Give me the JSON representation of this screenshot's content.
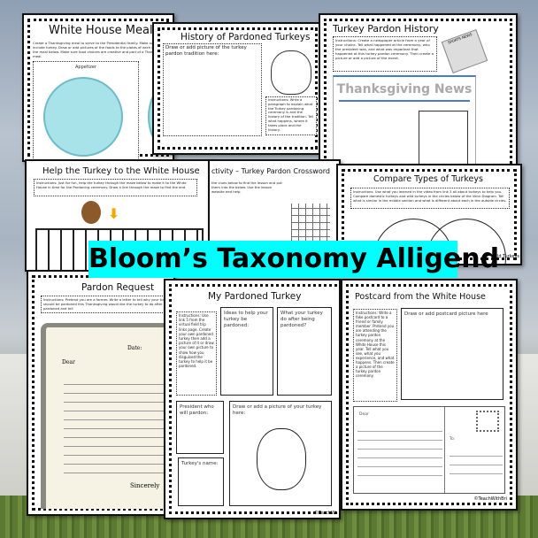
{
  "banner": {
    "title": "Bloom’s Taxonomy Alligend",
    "color": "#00ffff"
  },
  "pages": {
    "meal": {
      "title": "White House Meal",
      "instructions": "Create a Thanksgiving meal to serve to the Presidential family. Make sure to include turkey. Draw or add pictures of the foods to the plates of each course of the meal below. Make sure food choices are creative and part of a Thanksgiving meal.",
      "section": "Appetizer"
    },
    "history": {
      "title": "History of Pardoned Turkeys",
      "draw_label": "Draw or add picture of the turkey pardon tradition here:",
      "instructions": "Instructions: Write a paragraph to explain what the Turkey pardoning ceremony is and the history of the tradition. Tell what happens, where it takes place and the history."
    },
    "pardon_history": {
      "title": "Turkey Pardon History",
      "instructions": "Instructions: Create a newspaper article from a year of your choice. Tell what happened at the ceremony, who the president was, and what was important that happened at this turkey pardon ceremony. Then create a picture or add a picture of the event.",
      "newspaper_label": "SPORTS NEWS",
      "news_header": "Thanksgiving News"
    },
    "maze": {
      "title": "Help the Turkey to the White House",
      "instructions": "Instructions: Just for fun, help the turkey through the maze below to make it to the White House in time for the Pardoning ceremony. Draw a line through the maze to find the end."
    },
    "crossword": {
      "title": "ctivity – Turkey Pardon Crossword",
      "instructions": "the clues below to find the lesson and put them into the below. Use the lesson website eed help."
    },
    "compare": {
      "title": "Compare Types of Turkeys",
      "instructions": "Instructions: Use what you learned in the video from link 3 all about turkeys to help you. Compare domestic turkeys and wild turkeys in the circles below of the Venn Diagram. Tell what is similar in the middle section and what is different about each in the outside circles.",
      "label_right": "ld Turkeys"
    },
    "request": {
      "title": "Pardon Request",
      "instructions": "Instructions: Pretend you are a farmer. Write a letter to tell why your turkey should be pardoned this Thanksgiving would like the turkey to do after be pardoned and tell",
      "date_label": "Date:",
      "dear_label": "Dear",
      "closing": "Sincerely"
    },
    "my_turkey": {
      "title": "My Pardoned Turkey",
      "instructions": "Instructions: Use link 5 from the virtual field trip links page. Create your own pardoned turkey then add a picture of it or draw your own picture to show how you disguised the turkey to help it be pardoned.",
      "ideas": "Ideas to help your turkey be pardoned:",
      "after": "What your turkey do after being pardoned?",
      "president": "President who will pardon:",
      "name": "Turkey's name:",
      "draw": "Draw or add a picture of your turkey here:",
      "copyright": "©TeachW"
    },
    "postcard": {
      "title": "Postcard from the White House",
      "instructions": "Instructions: Write a fake postcard to a friend or family member. Pretend you are attending the turkey pardon ceremony at the White House this year. Tell what you see, what you experience, and what happens. Then create a picture of the turkey pardon ceremony.",
      "picture_label": "Draw or add postcard picture here",
      "dear": "Dear",
      "to": "To:",
      "copyright": "©TeachWithBri"
    }
  }
}
